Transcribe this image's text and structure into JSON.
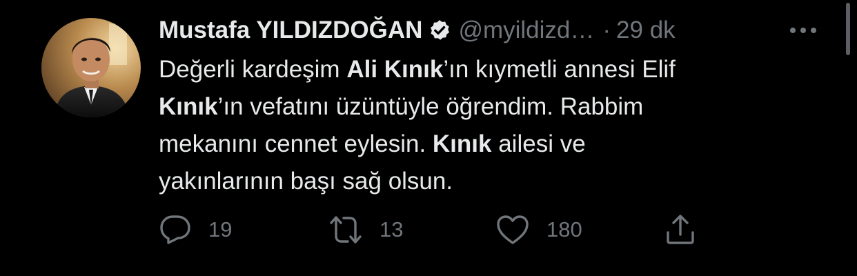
{
  "author": {
    "name": "Mustafa YILDIZDOĞAN",
    "handle": "@myildizd…",
    "separator": "·",
    "time": "29 dk",
    "verified": true
  },
  "tweet": {
    "segments": [
      [
        "Değerli kardeşim ",
        "Ali Kınık",
        "’ın kıymetli annesi Elif"
      ],
      [
        "Kınık",
        "’ın vefatını üzüntüyle öğrendim. Rabbim"
      ],
      [
        "mekanını cennet eylesin. ",
        "Kınık",
        " ailesi ve"
      ],
      [
        "yakınlarının başı sağ olsun."
      ]
    ]
  },
  "actions": {
    "reply_count": "19",
    "retweet_count": "13",
    "like_count": "180"
  },
  "colors": {
    "background": "#000000",
    "text": "#e7e9ea",
    "muted": "#71767b",
    "verified_badge": "#e7e9ea"
  },
  "icons": [
    "reply-icon",
    "retweet-icon",
    "like-icon",
    "share-icon",
    "more-icon",
    "verified-badge-icon"
  ]
}
